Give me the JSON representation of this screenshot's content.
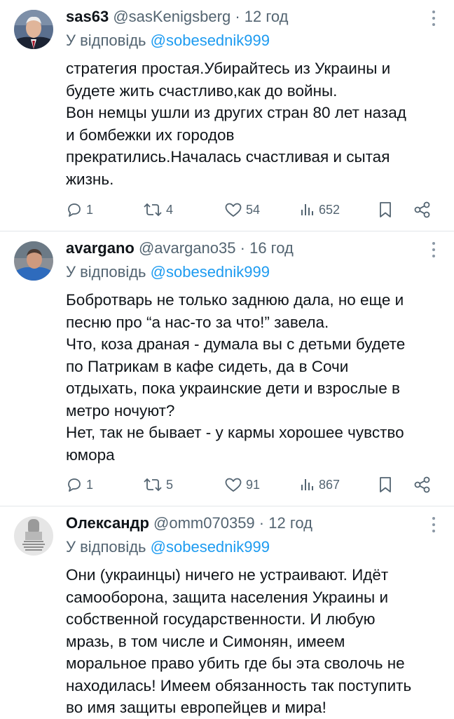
{
  "tweets": [
    {
      "name": "sas63",
      "handle": "@sasKenigsberg",
      "dot": "·",
      "time": "12 год",
      "reply_prefix": "У відповідь",
      "reply_to": "@sobesednik999",
      "lines": [
        "стратегия простая.Убирайтесь из Украины и",
        "будете жить счастливо,как до войны.",
        "Вон немцы ушли из других стран 80 лет назад",
        "и бомбежки их городов",
        "прекратились.Началась счастливая и сытая",
        "жизнь."
      ],
      "replies": "1",
      "retweets": "4",
      "likes": "54",
      "views": "652",
      "avatar": "avatar-photo-grey-haired-man"
    },
    {
      "name": "avargano",
      "handle": "@avargano35",
      "dot": "·",
      "time": "16 год",
      "reply_prefix": "У відповідь",
      "reply_to": "@sobesednik999",
      "lines": [
        "Бобротварь не только заднюю дала, но еще и",
        "песню про “а нас-то за что!” завела.",
        "Что, коза драная - думала вы с детьми будете",
        "по Патрикам в кафе сидеть, да в Сочи",
        "отдыхать, пока украинские дети и взрослые в",
        "метро ночуют?",
        "Нет, так не бывает - у кармы хорошее чувство",
        "юмора"
      ],
      "replies": "1",
      "retweets": "5",
      "likes": "91",
      "views": "867",
      "avatar": "avatar-photo-man-blue-shirt"
    },
    {
      "name": "Олександр",
      "handle": "@omm070359",
      "dot": "·",
      "time": "12 год",
      "reply_prefix": "У відповідь",
      "reply_to": "@sobesednik999",
      "lines": [
        "Они (украинцы) ничего не устраивают. Идёт",
        "самооборона, защита населения Украины и",
        "собственной государственности. И любую",
        "мразь, в том числе и Симонян, имеем",
        "моральное право убить где бы эта сволочь не",
        "находилась! Имеем обязанность так поступить",
        "во имя защиты европейцев и мира!"
      ],
      "avatar": "avatar-monument-with-text"
    }
  ],
  "colors": {
    "text": "#0f1419",
    "secondary": "#536471",
    "link": "#1d9bf0",
    "divider": "#e2e6e9"
  },
  "icons": [
    "reply-icon",
    "retweet-icon",
    "like-icon",
    "views-icon",
    "bookmark-icon",
    "share-icon",
    "more-icon"
  ]
}
